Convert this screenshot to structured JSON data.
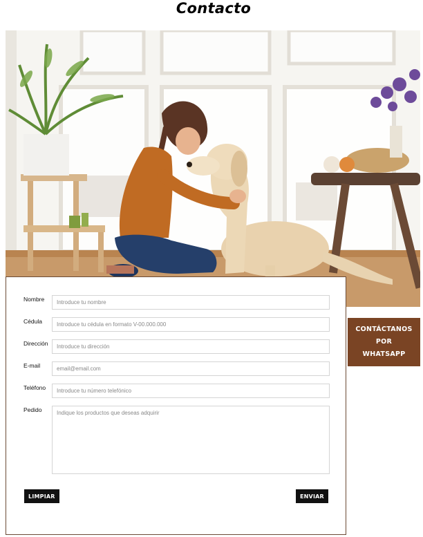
{
  "page": {
    "title": "Contacto"
  },
  "hero": {
    "image_name": "woman-with-golden-retriever-photo"
  },
  "whatsapp": {
    "line1": "CONTÁCTANOS",
    "line2": "POR",
    "line3": "WHATSAPP",
    "color": "#7a4424"
  },
  "form": {
    "fields": [
      {
        "label": "Nombre",
        "placeholder": "Introduce tu nombre",
        "value": ""
      },
      {
        "label": "Cédula",
        "placeholder": "Introduce tu cédula en formato V-00.000.000",
        "value": ""
      },
      {
        "label": "Dirección",
        "placeholder": "Introduce tu dirección",
        "value": ""
      },
      {
        "label": "E-mail",
        "placeholder": "email@email.com",
        "value": ""
      },
      {
        "label": "Teléfono",
        "placeholder": "Introduce tu número telefónico",
        "value": ""
      },
      {
        "label": "Pedido",
        "placeholder": "Indique los productos que deseas adquirir",
        "value": ""
      }
    ],
    "clear_label": "LIMPIAR",
    "submit_label": "ENVIAR"
  },
  "colors": {
    "card_border": "#6b4a34",
    "button_bg": "#111111"
  }
}
